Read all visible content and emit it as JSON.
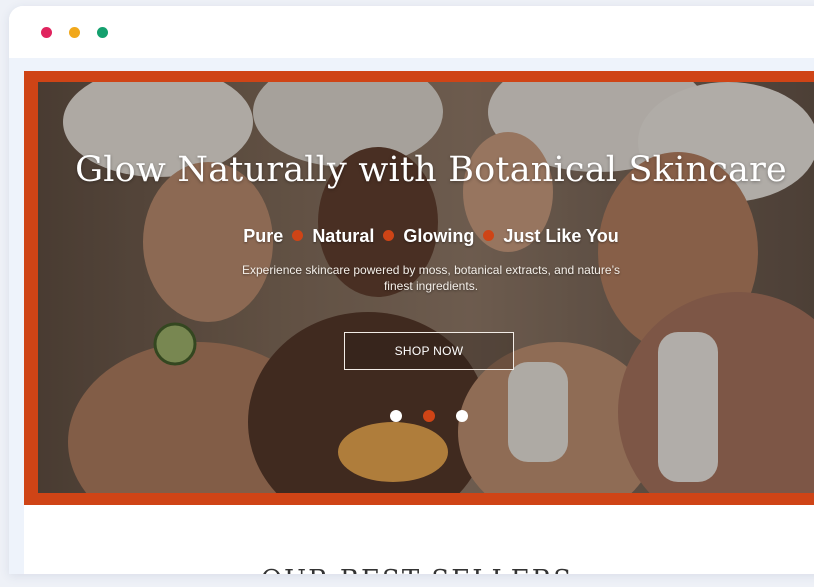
{
  "window": {
    "controls": [
      "close",
      "minimize",
      "zoom"
    ],
    "colors": {
      "close": "#e0245e",
      "minimize": "#f1a81b",
      "zoom": "#14a06e"
    }
  },
  "hero": {
    "title": "Glow Naturally with Botanical Skincare",
    "tagline": [
      "Pure",
      "Natural",
      "Glowing",
      "Just Like You"
    ],
    "description": "Experience skincare powered by moss, botanical extracts, and nature’s finest ingredients.",
    "cta_label": "SHOP NOW",
    "carousel": {
      "slides": 3,
      "active": 2
    },
    "accent_color": "#cf4416",
    "image": "women-in-towels-facial-care-photo"
  },
  "best_sellers": {
    "title": "OUR BEST SELLERS"
  }
}
